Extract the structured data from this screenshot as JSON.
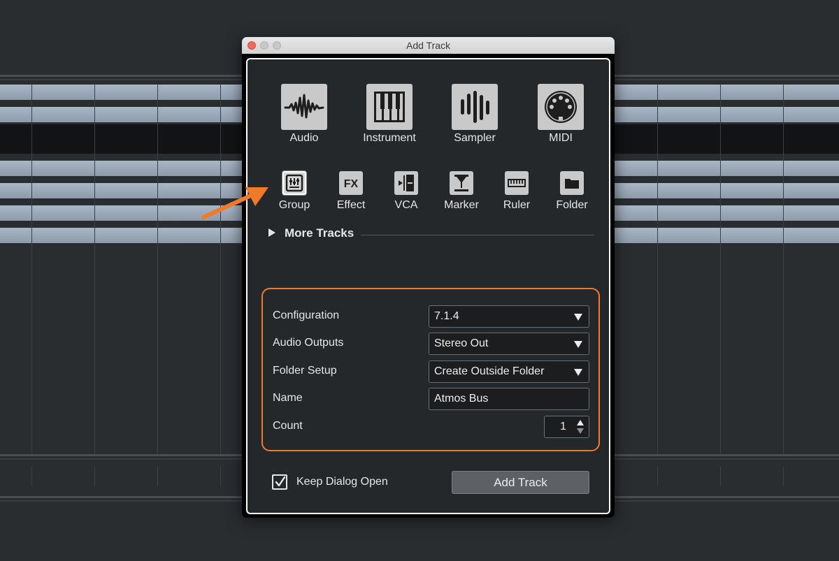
{
  "dialog": {
    "title": "Add Track"
  },
  "track_types_large": [
    {
      "label": "Audio",
      "icon": "audio-waveform-icon"
    },
    {
      "label": "Instrument",
      "icon": "piano-keys-icon"
    },
    {
      "label": "Sampler",
      "icon": "sampler-bars-icon"
    },
    {
      "label": "MIDI",
      "icon": "midi-connector-icon"
    }
  ],
  "track_types_small": [
    {
      "label": "Group",
      "icon": "group-faders-icon",
      "selected": true
    },
    {
      "label": "Effect",
      "icon": "fx-icon",
      "icon_text": "FX"
    },
    {
      "label": "VCA",
      "icon": "vca-fader-icon"
    },
    {
      "label": "Marker",
      "icon": "marker-icon"
    },
    {
      "label": "Ruler",
      "icon": "ruler-icon"
    },
    {
      "label": "Folder",
      "icon": "folder-icon"
    }
  ],
  "more_tracks": {
    "label": "More Tracks"
  },
  "settings": {
    "configuration": {
      "label": "Configuration",
      "value": "7.1.4"
    },
    "audio_outputs": {
      "label": "Audio Outputs",
      "value": "Stereo Out"
    },
    "folder_setup": {
      "label": "Folder Setup",
      "value": "Create Outside Folder"
    },
    "name": {
      "label": "Name",
      "value": "Atmos Bus"
    },
    "count": {
      "label": "Count",
      "value": "1"
    }
  },
  "footer": {
    "keep_open_label": "Keep Dialog Open",
    "keep_open_checked": true,
    "add_button_label": "Add Track"
  },
  "colors": {
    "highlight_orange": "#f07a2a",
    "panel_bg": "#25282b",
    "tile_bg": "#c9c9c9"
  }
}
